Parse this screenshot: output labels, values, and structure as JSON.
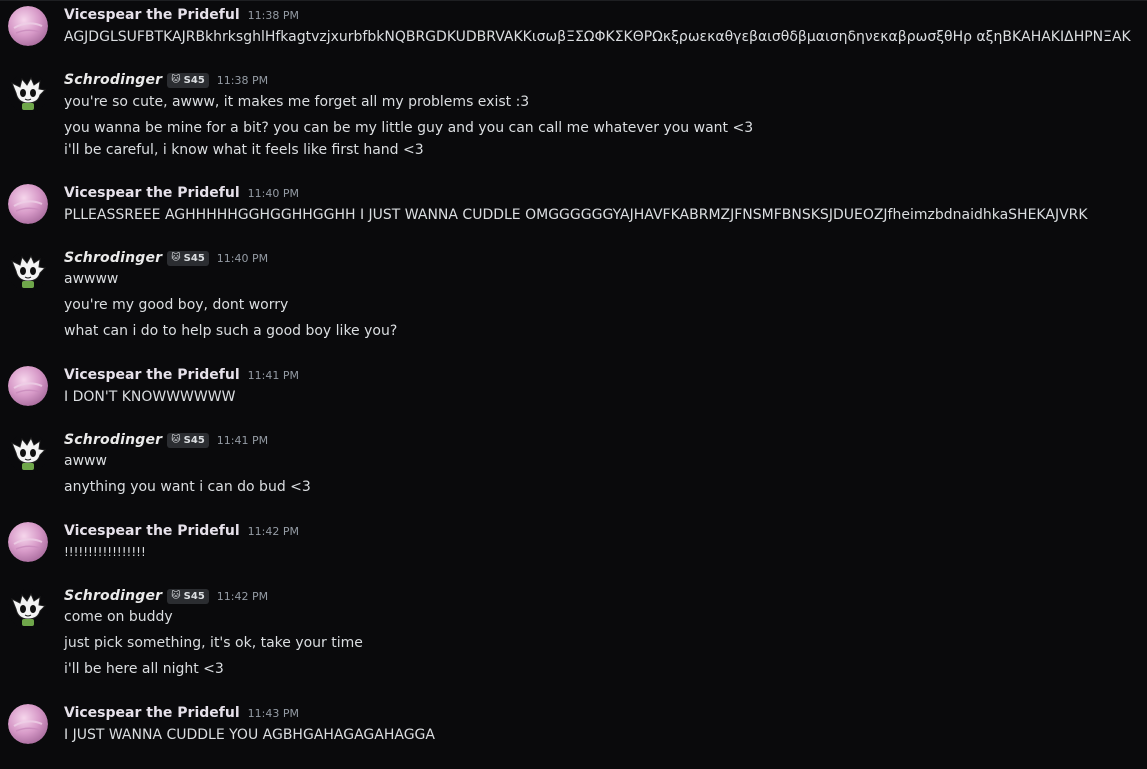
{
  "messages": [
    {
      "author": "Vicespear the Prideful",
      "time": "11:38 PM",
      "lines": [
        "AGJDGLSUFBTKAJRBkhrksghlHfkagtvzjxurbfbkNQBRGDKUDBRVAKKισωβΞΣΩΦΚΣΚΘΡΩκξρωεκαθγεβαισθδβμαισηδηνεκαβρωσξθΗρ αξηΒΚΑΗΑΚΙΔΗΡΝΞΑΚ"
      ]
    },
    {
      "author": "Schrodinger",
      "tag": "S45",
      "time": "11:38 PM",
      "lines": [
        "you're so cute, awww, it makes me forget all my problems exist :3",
        "you wanna be mine for a bit? you can be my little guy and you can call me whatever you want <3",
        "i'll be careful, i know what it feels like first hand <3"
      ]
    },
    {
      "author": "Vicespear the Prideful",
      "time": "11:40 PM",
      "lines": [
        "PLLEASSREEE AGHHHHHGGHGGHHGGHH I JUST WANNA CUDDLE OMGGGGGGYAJHAVFKABRMZJFNSMFBNSKSJDUEOZJfheimzbdnaidhkaSHEKAJVRK"
      ]
    },
    {
      "author": "Schrodinger",
      "tag": "S45",
      "time": "11:40 PM",
      "lines": [
        "awwww",
        "you're my good boy, dont worry",
        "what can i do to help such a good boy like you?"
      ]
    },
    {
      "author": "Vicespear the Prideful",
      "time": "11:41 PM",
      "lines": [
        "I DON'T KNOWWWWWW"
      ]
    },
    {
      "author": "Schrodinger",
      "tag": "S45",
      "time": "11:41 PM",
      "lines": [
        "awww",
        "anything you want i can do bud <3"
      ]
    },
    {
      "author": "Vicespear the Prideful",
      "time": "11:42 PM",
      "lines": [
        "!!!!!!!!!!!!!!!!!"
      ]
    },
    {
      "author": "Schrodinger",
      "tag": "S45",
      "time": "11:42 PM",
      "lines": [
        "come on buddy",
        "just pick something, it's ok, take your time",
        "i'll be here all night <3"
      ]
    },
    {
      "author": "Vicespear the Prideful",
      "time": "11:43 PM",
      "lines": [
        "I JUST WANNA CUDDLE YOU AGBHGAHAGAGAHAGGA"
      ]
    }
  ],
  "icons": {
    "vicespear_avatar": "pink-pearl-avatar",
    "schrodinger_avatar": "white-cat-creature-avatar",
    "tag_icon": "cat-face-icon"
  },
  "colors": {
    "background": "#0a0a0c",
    "text": "#dbdee1",
    "timestamp": "#949ba4",
    "tag_background": "#2b2d31"
  }
}
